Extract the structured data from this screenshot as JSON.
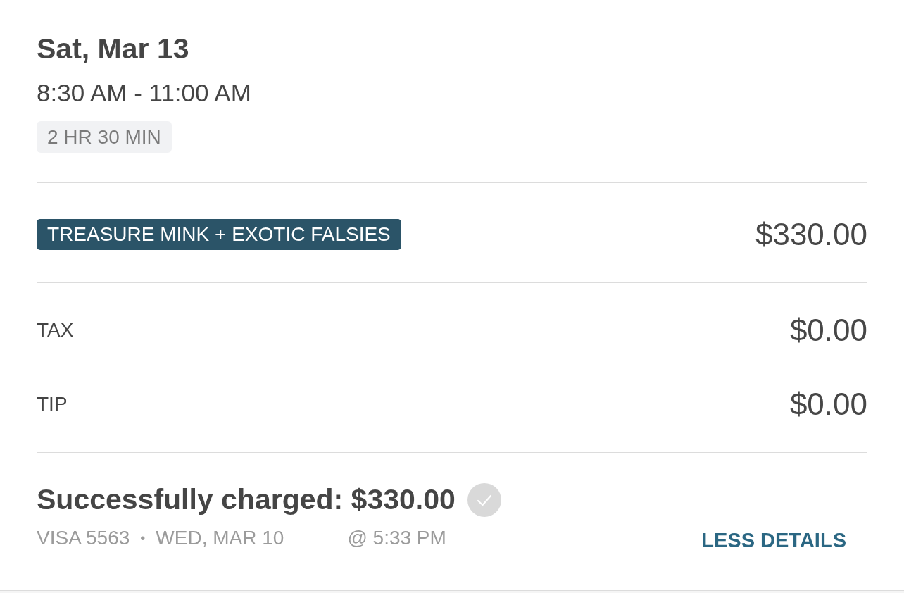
{
  "appointment": {
    "date": "Sat, Mar 13",
    "time_range": "8:30 AM - 11:00 AM",
    "duration": "2 HR 30 MIN"
  },
  "services": [
    {
      "name": "TREASURE MINK + EXOTIC FALSIES",
      "price": "$330.00"
    }
  ],
  "charges": [
    {
      "label": "TAX",
      "amount": "$0.00"
    },
    {
      "label": "TIP",
      "amount": "$0.00"
    }
  ],
  "payment": {
    "status": "Successfully charged: $330.00",
    "confirmed": true,
    "card": "VISA 5563",
    "separator": "•",
    "date": "WED, MAR 10",
    "time": "@ 5:33 PM",
    "toggle_label": "LESS DETAILS"
  }
}
